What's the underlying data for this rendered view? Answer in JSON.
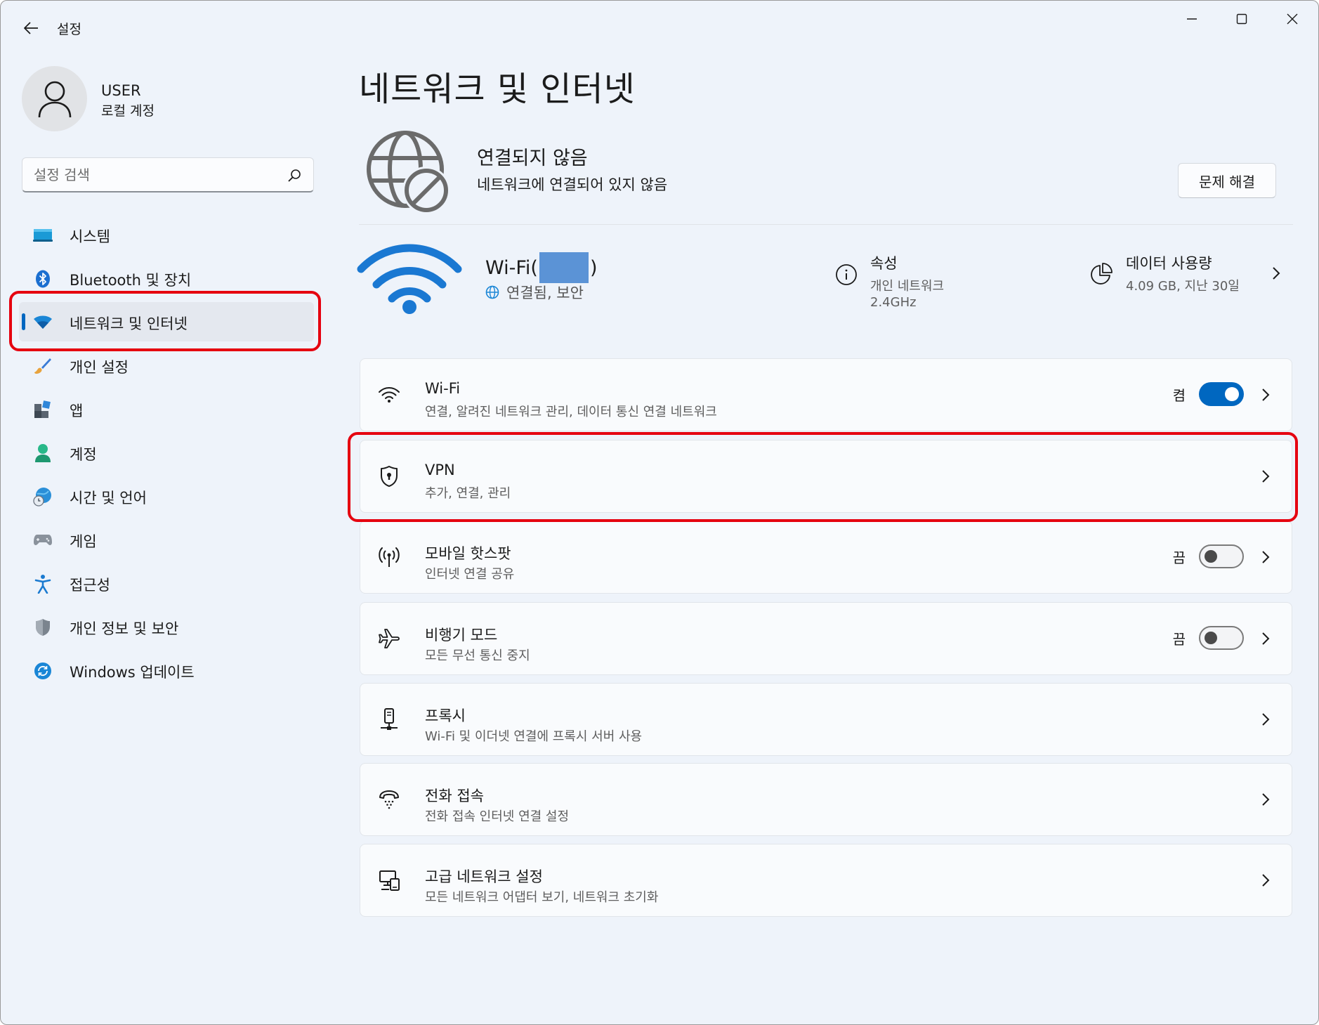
{
  "window": {
    "title": "설정"
  },
  "user": {
    "name": "USER",
    "account_type": "로컬 계정"
  },
  "search": {
    "placeholder": "설정 검색"
  },
  "sidebar": {
    "items": [
      {
        "label": "시스템",
        "icon": "system-icon"
      },
      {
        "label": "Bluetooth 및 장치",
        "icon": "bluetooth-icon"
      },
      {
        "label": "네트워크 및 인터넷",
        "icon": "wifi-icon",
        "active": true
      },
      {
        "label": "개인 설정",
        "icon": "brush-icon"
      },
      {
        "label": "앱",
        "icon": "apps-icon"
      },
      {
        "label": "계정",
        "icon": "account-icon"
      },
      {
        "label": "시간 및 언어",
        "icon": "time-language-icon"
      },
      {
        "label": "게임",
        "icon": "gamepad-icon"
      },
      {
        "label": "접근성",
        "icon": "accessibility-icon"
      },
      {
        "label": "개인 정보 및 보안",
        "icon": "shield-icon"
      },
      {
        "label": "Windows 업데이트",
        "icon": "update-icon"
      }
    ]
  },
  "main": {
    "page_title": "네트워크 및 인터넷",
    "status": {
      "title": "연결되지 않음",
      "subtitle": "네트워크에 연결되어 있지 않음",
      "troubleshoot_label": "문제 해결"
    },
    "connection": {
      "name_prefix": "Wi-Fi(",
      "name_suffix": ")",
      "status_text": "연결됨, 보안",
      "properties_title": "속성",
      "properties_line1": "개인 네트워크",
      "properties_line2": "2.4GHz",
      "data_usage_title": "데이터 사용량",
      "data_usage_sub": "4.09 GB, 지난 30일"
    },
    "cards": [
      {
        "title": "Wi-Fi",
        "subtitle": "연결, 알려진 네트워크 관리, 데이터 통신 연결 네트워크",
        "icon": "wifi-icon",
        "toggle": "on",
        "state_label": "켬"
      },
      {
        "title": "VPN",
        "subtitle": "추가, 연결, 관리",
        "icon": "vpn-shield-icon"
      },
      {
        "title": "모바일 핫스팟",
        "subtitle": "인터넷 연결 공유",
        "icon": "hotspot-icon",
        "toggle": "off",
        "state_label": "끔"
      },
      {
        "title": "비행기 모드",
        "subtitle": "모든 무선 통신 중지",
        "icon": "airplane-icon",
        "toggle": "off",
        "state_label": "끔"
      },
      {
        "title": "프록시",
        "subtitle": "Wi-Fi 및 이더넷 연결에 프록시 서버 사용",
        "icon": "proxy-icon"
      },
      {
        "title": "전화 접속",
        "subtitle": "전화 접속 인터넷 연결 설정",
        "icon": "dialup-icon"
      },
      {
        "title": "고급 네트워크 설정",
        "subtitle": "모든 네트워크 어댑터 보기, 네트워크 초기화",
        "icon": "network-adapter-icon"
      }
    ]
  },
  "colors": {
    "accent": "#0067c0",
    "highlight_annotation": "#e5000f",
    "window_bg": "#eef3fa"
  }
}
